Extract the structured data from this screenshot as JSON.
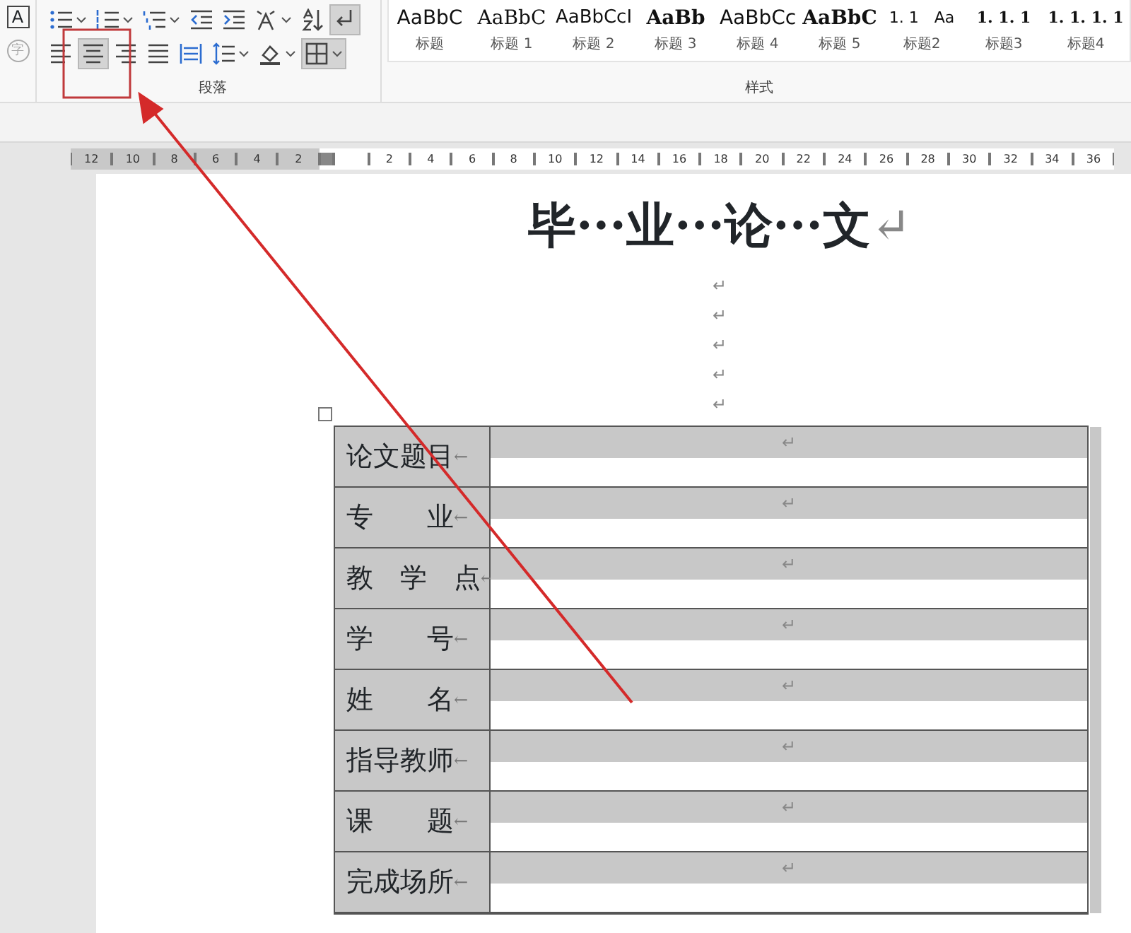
{
  "ribbon": {
    "left_group": [
      {
        "glyph": "A",
        "disabled": false
      },
      {
        "glyph": "字",
        "disabled": true
      }
    ],
    "paragraph_group": {
      "label": "段落",
      "row_1": [
        {
          "kind": "bullets",
          "dropdown": true,
          "selected": false
        },
        {
          "kind": "numbering",
          "dropdown": true,
          "selected": false
        },
        {
          "kind": "multilevel",
          "dropdown": true,
          "selected": false
        },
        {
          "kind": "outdent",
          "dropdown": false,
          "selected": false
        },
        {
          "kind": "indent",
          "dropdown": false,
          "selected": false
        },
        {
          "kind": "asian-layout",
          "dropdown": true,
          "selected": false
        },
        {
          "kind": "sort",
          "dropdown": false,
          "selected": false
        },
        {
          "kind": "marks",
          "dropdown": false,
          "selected": true
        }
      ],
      "row_2": [
        {
          "kind": "align-left",
          "dropdown": false,
          "selected": false
        },
        {
          "kind": "align-center",
          "dropdown": false,
          "selected": true
        },
        {
          "kind": "align-right",
          "dropdown": false,
          "selected": false
        },
        {
          "kind": "justify",
          "dropdown": false,
          "selected": false
        },
        {
          "kind": "distribute",
          "dropdown": false,
          "selected": false
        },
        {
          "kind": "line-spacing",
          "dropdown": true,
          "selected": false
        },
        {
          "kind": "shading",
          "dropdown": true,
          "selected": false
        },
        {
          "kind": "borders",
          "dropdown": true,
          "selected": true
        }
      ]
    },
    "styles_group": {
      "label": "样式",
      "styles": [
        {
          "preview": "AaBbC",
          "label": "标题",
          "kind": "sans"
        },
        {
          "preview": "AaBbC",
          "label": "标题 1",
          "kind": "serif"
        },
        {
          "preview": "AaBbCcI",
          "label": "标题 2",
          "kind": "narrow"
        },
        {
          "preview": "AaBb",
          "label": "标题 3",
          "kind": "bold-serif"
        },
        {
          "preview": "AaBbCc",
          "label": "标题 4",
          "kind": "sans"
        },
        {
          "preview": "AaBbC",
          "label": "标题 5",
          "kind": "bold-serif"
        },
        {
          "preview": "1. 1　Aa",
          "label": "标题2",
          "kind": "small"
        },
        {
          "preview": "1. 1. 1",
          "label": "标题3",
          "kind": "numbered"
        },
        {
          "preview": "1. 1. 1. 1",
          "label": "标题4",
          "kind": "numbered"
        }
      ]
    }
  },
  "ruler": {
    "left_numbers": [
      "12",
      "10",
      "8",
      "6",
      "4",
      "2"
    ],
    "right_numbers": [
      "2",
      "4",
      "6",
      "8",
      "10",
      "12",
      "14",
      "16",
      "18",
      "20",
      "22",
      "24",
      "26",
      "28",
      "30",
      "32",
      "34",
      "36"
    ]
  },
  "document": {
    "title": "毕···业···论···文",
    "title_mark": "↵",
    "blank_paragraphs": [
      "↵",
      "↵",
      "↵",
      "↵",
      "↵"
    ],
    "table": {
      "rows": [
        {
          "label": "论文题目",
          "end_mark": "←",
          "value_mark": "↵"
        },
        {
          "label": "专　　业",
          "end_mark": "←",
          "value_mark": "↵"
        },
        {
          "label": "教　学　点",
          "end_mark": "←",
          "value_mark": "↵"
        },
        {
          "label": "学　　号",
          "end_mark": "←",
          "value_mark": "↵"
        },
        {
          "label": "姓　　名",
          "end_mark": "←",
          "value_mark": "↵"
        },
        {
          "label": "指导教师",
          "end_mark": "←",
          "value_mark": "↵"
        },
        {
          "label": "课　　题",
          "end_mark": "←",
          "value_mark": "↵"
        },
        {
          "label": "完成场所",
          "end_mark": "←",
          "value_mark": "↵"
        }
      ]
    }
  }
}
